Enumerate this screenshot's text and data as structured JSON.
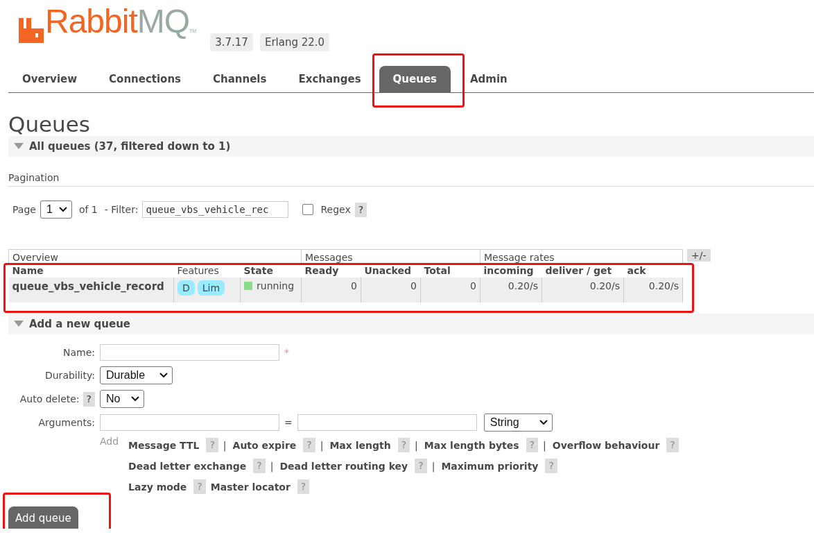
{
  "logo": {
    "brand": "Rabbit",
    "suffix": "MQ",
    "mark": "TM"
  },
  "versions": [
    "3.7.17",
    "Erlang 22.0"
  ],
  "tabs": [
    {
      "label": "Overview",
      "selected": false,
      "highlighted": false
    },
    {
      "label": "Connections",
      "selected": false,
      "highlighted": false
    },
    {
      "label": "Channels",
      "selected": false,
      "highlighted": false
    },
    {
      "label": "Exchanges",
      "selected": false,
      "highlighted": false
    },
    {
      "label": "Queues",
      "selected": true,
      "highlighted": true
    },
    {
      "label": "Admin",
      "selected": false,
      "highlighted": false
    }
  ],
  "title": "Queues",
  "all_queues": {
    "heading": "All queues (37, filtered down to 1)",
    "expanded": true
  },
  "pagination": {
    "label": "Pagination",
    "page_label": "Page",
    "page": "1",
    "of": "of 1",
    "filter_label": "- Filter:",
    "filter_value": "queue_vbs_vehicle_rec",
    "regex_label": "Regex",
    "regex_checked": false,
    "help": "?"
  },
  "table": {
    "highlighted": true,
    "toggle": "+/-",
    "groups": [
      "Overview",
      "Messages",
      "Message rates"
    ],
    "columns": [
      "Name",
      "Features",
      "State",
      "Ready",
      "Unacked",
      "Total",
      "incoming",
      "deliver / get",
      "ack"
    ],
    "rows": [
      {
        "name": "queue_vbs_vehicle_record",
        "features": [
          "D",
          "Lim"
        ],
        "state": "running",
        "color": "#88dd88",
        "ready": "0",
        "unacked": "0",
        "total": "0",
        "incoming": "0.20/s",
        "deliver_get": "0.20/s",
        "ack": "0.20/s"
      }
    ]
  },
  "add_queue": {
    "heading": "Add a new queue",
    "expanded": true,
    "name_label": "Name:",
    "required_mark": "*",
    "durability_label": "Durability:",
    "durability": "Durable",
    "auto_delete_label": "Auto delete:",
    "auto_delete_help": "?",
    "auto_delete": "No",
    "arguments_label": "Arguments:",
    "equals": "=",
    "type": "String",
    "add_label": "Add",
    "shortcut_lines": [
      [
        {
          "label": "Message TTL",
          "help": "?",
          "separator": "|"
        },
        {
          "label": "Auto expire",
          "help": "?",
          "separator": "|"
        },
        {
          "label": "Max length",
          "help": "?",
          "separator": "|"
        },
        {
          "label": "Max length bytes",
          "help": "?",
          "separator": "|"
        },
        {
          "label": "Overflow behaviour",
          "help": "?"
        }
      ],
      [
        {
          "label": "Dead letter exchange",
          "help": "?",
          "separator": "|"
        },
        {
          "label": "Dead letter routing key",
          "help": "?",
          "separator": "|"
        },
        {
          "label": "Maximum priority",
          "help": "?"
        }
      ],
      [
        {
          "label": "Lazy mode",
          "help": "?"
        },
        {
          "label": "Master locator",
          "help": "?"
        }
      ]
    ],
    "button": {
      "label": "Add queue",
      "highlighted": true
    }
  }
}
